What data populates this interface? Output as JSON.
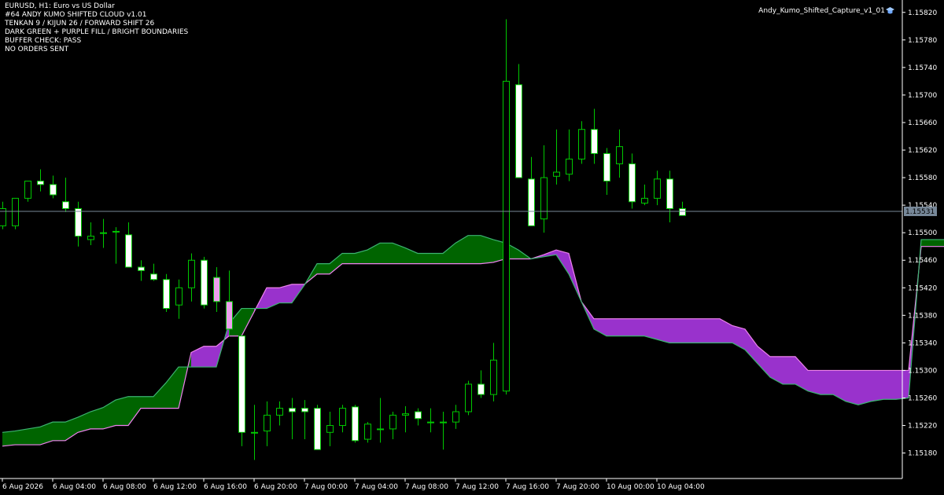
{
  "header": {
    "symbol_line": "EURUSD, H1:  Euro vs US Dollar",
    "lines": [
      "#64 ANDY KUMO SHIFTED CLOUD v1.01",
      "TENKAN 9 / KIJUN 26 / FORWARD SHIFT 26",
      "DARK GREEN + PURPLE FILL / BRIGHT BOUNDARIES",
      "BUFFER CHECK: PASS",
      "NO ORDERS SENT"
    ],
    "indicator_name": "Andy_Kumo_Shifted_Capture_v1_01"
  },
  "colors": {
    "background": "#000000",
    "bull_candle": "#ffffff",
    "bear_candle": "#000000",
    "wick": "#00c800",
    "cloud_bull_fill": "#006400",
    "cloud_bear_fill": "#9932cc",
    "span_a_line": "#3cb371",
    "span_b_line": "#ee82ee",
    "price_line": "#778899",
    "axis": "#ffffff",
    "highlight_candle": "#ee9fee"
  },
  "chart_data": {
    "type": "candlestick",
    "symbol": "EURUSD",
    "timeframe": "H1",
    "y_ticks": [
      1.1582,
      1.1578,
      1.1574,
      1.157,
      1.1566,
      1.1562,
      1.1558,
      1.1554,
      1.155,
      1.1546,
      1.1542,
      1.1538,
      1.1534,
      1.153,
      1.1526,
      1.1522,
      1.1518
    ],
    "y_tick_labels": [
      "1.15820",
      "1.15780",
      "1.15740",
      "1.15700",
      "1.15660",
      "1.15620",
      "1.15580",
      "1.15540",
      "1.15500",
      "1.15460",
      "1.15420",
      "1.15380",
      "1.15340",
      "1.15300",
      "1.15260",
      "1.15220",
      "1.15180"
    ],
    "ylim": [
      1.15143,
      1.15838
    ],
    "x_tick_labels": [
      "6 Aug 2026",
      "6 Aug 04:00",
      "6 Aug 08:00",
      "6 Aug 12:00",
      "6 Aug 16:00",
      "6 Aug 20:00",
      "7 Aug 00:00",
      "7 Aug 04:00",
      "7 Aug 08:00",
      "7 Aug 12:00",
      "7 Aug 16:00",
      "7 Aug 20:00",
      "10 Aug 00:00",
      "10 Aug 04:00"
    ],
    "current_price": 1.15531,
    "current_price_label": "1.15531",
    "candles": [
      {
        "o": 1.1551,
        "h": 1.15545,
        "l": 1.15505,
        "c": 1.15535
      },
      {
        "o": 1.1551,
        "h": 1.1555,
        "l": 1.15505,
        "c": 1.1555
      },
      {
        "o": 1.1555,
        "h": 1.15575,
        "l": 1.15545,
        "c": 1.15575
      },
      {
        "o": 1.15575,
        "h": 1.15592,
        "l": 1.1556,
        "c": 1.1557
      },
      {
        "o": 1.1557,
        "h": 1.15583,
        "l": 1.1555,
        "c": 1.15555
      },
      {
        "o": 1.15545,
        "h": 1.1558,
        "l": 1.1553,
        "c": 1.15535
      },
      {
        "o": 1.15535,
        "h": 1.15545,
        "l": 1.1548,
        "c": 1.15495
      },
      {
        "o": 1.1549,
        "h": 1.15515,
        "l": 1.15482,
        "c": 1.15495
      },
      {
        "o": 1.155,
        "h": 1.1552,
        "l": 1.15478,
        "c": 1.155
      },
      {
        "o": 1.15502,
        "h": 1.15508,
        "l": 1.15455,
        "c": 1.15502
      },
      {
        "o": 1.15497,
        "h": 1.15515,
        "l": 1.1545,
        "c": 1.1545
      },
      {
        "o": 1.1545,
        "h": 1.1546,
        "l": 1.1543,
        "c": 1.15445
      },
      {
        "o": 1.1544,
        "h": 1.15455,
        "l": 1.1543,
        "c": 1.15432
      },
      {
        "o": 1.15432,
        "h": 1.1544,
        "l": 1.15385,
        "c": 1.1539
      },
      {
        "o": 1.15395,
        "h": 1.15432,
        "l": 1.15375,
        "c": 1.1542
      },
      {
        "o": 1.1542,
        "h": 1.1547,
        "l": 1.154,
        "c": 1.1546
      },
      {
        "o": 1.1546,
        "h": 1.15465,
        "l": 1.1539,
        "c": 1.15395
      },
      {
        "o": 1.15435,
        "h": 1.1545,
        "l": 1.15385,
        "c": 1.154
      },
      {
        "o": 1.154,
        "h": 1.15445,
        "l": 1.1535,
        "c": 1.1536
      },
      {
        "o": 1.1535,
        "h": 1.1535,
        "l": 1.1519,
        "c": 1.1521
      },
      {
        "o": 1.1521,
        "h": 1.1525,
        "l": 1.1517,
        "c": 1.1521
      },
      {
        "o": 1.15212,
        "h": 1.15255,
        "l": 1.1519,
        "c": 1.15235
      },
      {
        "o": 1.15235,
        "h": 1.15255,
        "l": 1.1522,
        "c": 1.15245
      },
      {
        "o": 1.15245,
        "h": 1.1526,
        "l": 1.152,
        "c": 1.1524
      },
      {
        "o": 1.15245,
        "h": 1.15257,
        "l": 1.152,
        "c": 1.1524
      },
      {
        "o": 1.15245,
        "h": 1.1525,
        "l": 1.15185,
        "c": 1.15185
      },
      {
        "o": 1.1521,
        "h": 1.1524,
        "l": 1.1519,
        "c": 1.1522
      },
      {
        "o": 1.1522,
        "h": 1.1525,
        "l": 1.1521,
        "c": 1.15245
      },
      {
        "o": 1.15247,
        "h": 1.1525,
        "l": 1.15195,
        "c": 1.15198
      },
      {
        "o": 1.152,
        "h": 1.15225,
        "l": 1.15195,
        "c": 1.15222
      },
      {
        "o": 1.15215,
        "h": 1.1526,
        "l": 1.15195,
        "c": 1.15215
      },
      {
        "o": 1.15215,
        "h": 1.1524,
        "l": 1.152,
        "c": 1.15235
      },
      {
        "o": 1.15235,
        "h": 1.15248,
        "l": 1.1521,
        "c": 1.15237
      },
      {
        "o": 1.1524,
        "h": 1.15245,
        "l": 1.1522,
        "c": 1.1523
      },
      {
        "o": 1.15225,
        "h": 1.15245,
        "l": 1.1521,
        "c": 1.15225
      },
      {
        "o": 1.15225,
        "h": 1.1524,
        "l": 1.15185,
        "c": 1.15225
      },
      {
        "o": 1.15225,
        "h": 1.1525,
        "l": 1.15215,
        "c": 1.1524
      },
      {
        "o": 1.1524,
        "h": 1.15285,
        "l": 1.15235,
        "c": 1.1528
      },
      {
        "o": 1.1528,
        "h": 1.153,
        "l": 1.1526,
        "c": 1.15265
      },
      {
        "o": 1.15265,
        "h": 1.1534,
        "l": 1.15255,
        "c": 1.15315
      },
      {
        "o": 1.1527,
        "h": 1.1581,
        "l": 1.15265,
        "c": 1.1572
      },
      {
        "o": 1.15715,
        "h": 1.15745,
        "l": 1.1558,
        "c": 1.1558
      },
      {
        "o": 1.15578,
        "h": 1.1561,
        "l": 1.1551,
        "c": 1.1551
      },
      {
        "o": 1.1552,
        "h": 1.15627,
        "l": 1.155,
        "c": 1.1558
      },
      {
        "o": 1.15582,
        "h": 1.1565,
        "l": 1.1557,
        "c": 1.15588
      },
      {
        "o": 1.15585,
        "h": 1.1565,
        "l": 1.15575,
        "c": 1.15607
      },
      {
        "o": 1.15607,
        "h": 1.15662,
        "l": 1.156,
        "c": 1.1565
      },
      {
        "o": 1.1565,
        "h": 1.1568,
        "l": 1.156,
        "c": 1.15615
      },
      {
        "o": 1.15615,
        "h": 1.15623,
        "l": 1.15555,
        "c": 1.15575
      },
      {
        "o": 1.156,
        "h": 1.1565,
        "l": 1.1558,
        "c": 1.15625
      },
      {
        "o": 1.156,
        "h": 1.15615,
        "l": 1.15535,
        "c": 1.15545
      },
      {
        "o": 1.15543,
        "h": 1.1557,
        "l": 1.1554,
        "c": 1.1555
      },
      {
        "o": 1.1555,
        "h": 1.1559,
        "l": 1.1554,
        "c": 1.15578
      },
      {
        "o": 1.15578,
        "h": 1.1559,
        "l": 1.15515,
        "c": 1.15535
      },
      {
        "o": 1.15535,
        "h": 1.15545,
        "l": 1.15525,
        "c": 1.15525
      }
    ],
    "cloud_span_a": [
      [
        1.1521,
        1.15212,
        1.15215,
        1.15218,
        1.15225,
        1.15225,
        1.15232,
        1.1524,
        1.15246,
        1.15257,
        1.15262,
        1.15262,
        1.15262,
        1.15282,
        1.15305,
        1.15305,
        1.15305,
        1.15305,
        1.15368,
        1.1539,
        1.1539,
        1.1539,
        1.15398,
        1.15398,
        1.15424,
        1.15455,
        1.15455,
        1.1547,
        1.1547,
        1.15475,
        1.15485,
        1.15485,
        1.15478,
        1.1547,
        1.1547,
        1.1547,
        1.15485,
        1.15496,
        1.15496,
        1.1549,
        1.15485,
        1.15475,
        1.15462
      ]
    ],
    "cloud_span_b": [
      [
        1.1519,
        1.15192,
        1.15192,
        1.15192,
        1.15198,
        1.15198,
        1.1521,
        1.15215,
        1.15215,
        1.1522,
        1.1522,
        1.15245,
        1.15245,
        1.15245,
        1.15245,
        1.15326,
        1.15335,
        1.15335,
        1.1535,
        1.1535,
        1.15385,
        1.1542,
        1.1542,
        1.15425,
        1.15425,
        1.1544,
        1.1544,
        1.15455,
        1.15455,
        1.15455,
        1.15455,
        1.15455,
        1.15455,
        1.15455,
        1.15455,
        1.15455,
        1.15455,
        1.15455,
        1.15455,
        1.15457,
        1.15462,
        1.15462,
        1.15462
      ]
    ],
    "future_span_a": [
      1.15462,
      1.15465,
      1.15468,
      1.1544,
      1.154,
      1.1536,
      1.1535,
      1.1535,
      1.1535,
      1.1535,
      1.15345,
      1.1534,
      1.1534,
      1.1534,
      1.1534,
      1.1534,
      1.1534,
      1.1533,
      1.1531,
      1.1529,
      1.1528,
      1.1528,
      1.1527,
      1.15265,
      1.15265,
      1.15255,
      1.1525,
      1.15255,
      1.15258,
      1.15258,
      1.1526,
      1.1549,
      1.1549,
      1.1549,
      1.1549,
      1.15495,
      1.15505
    ],
    "future_span_b": [
      1.15462,
      1.15468,
      1.15475,
      1.1547,
      1.154,
      1.15375,
      1.15375,
      1.15375,
      1.15375,
      1.15375,
      1.15375,
      1.15375,
      1.15375,
      1.15375,
      1.15375,
      1.15375,
      1.15365,
      1.1536,
      1.15335,
      1.1532,
      1.1532,
      1.1532,
      1.153,
      1.153,
      1.153,
      1.153,
      1.153,
      1.153,
      1.153,
      1.153,
      1.153,
      1.1548,
      1.1548,
      1.1548,
      1.1548,
      1.1548,
      1.15485
    ]
  }
}
